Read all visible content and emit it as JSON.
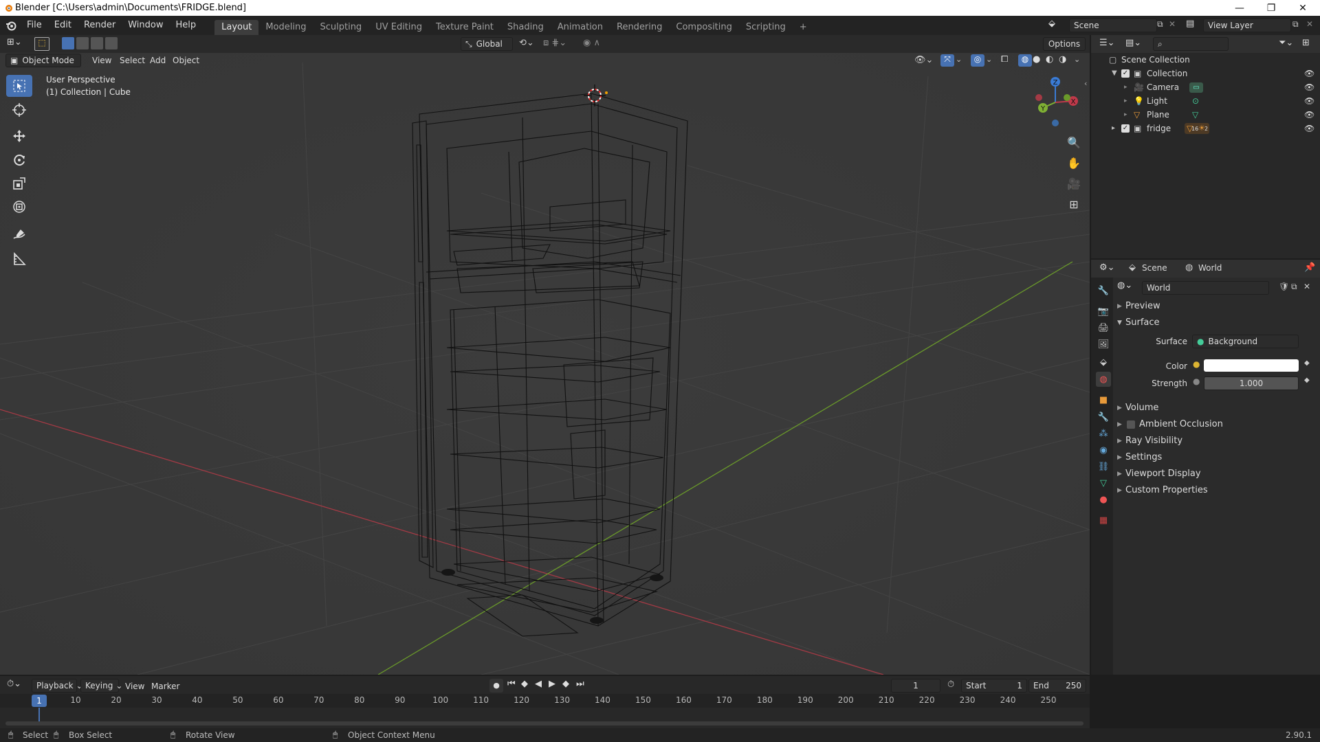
{
  "window": {
    "title": "Blender [C:\\Users\\admin\\Documents\\FRIDGE.blend]",
    "min_symbol": "—",
    "max_symbol": "❐",
    "close_symbol": "✕"
  },
  "menu": [
    "File",
    "Edit",
    "Render",
    "Window",
    "Help"
  ],
  "workspaces": [
    {
      "label": "Layout",
      "active": true
    },
    {
      "label": "Modeling"
    },
    {
      "label": "Sculpting"
    },
    {
      "label": "UV Editing"
    },
    {
      "label": "Texture Paint"
    },
    {
      "label": "Shading"
    },
    {
      "label": "Animation"
    },
    {
      "label": "Rendering"
    },
    {
      "label": "Compositing"
    },
    {
      "label": "Scripting"
    }
  ],
  "add_workspace": "+",
  "scene_field": "Scene",
  "view_layer_field": "View Layer",
  "tool_header": {
    "transform_orientation": "Global",
    "options": "Options"
  },
  "viewport_header": {
    "mode": "Object Mode",
    "menus": [
      "View",
      "Select",
      "Add",
      "Object"
    ]
  },
  "viewport": {
    "perspective": "User Perspective",
    "collection_info": "(1) Collection | Cube",
    "gizmo_labels": {
      "z": "Z",
      "y": "Y",
      "x": "X"
    }
  },
  "outliner": {
    "rows": [
      {
        "label": "Scene Collection"
      },
      {
        "label": "Collection"
      },
      {
        "label": "Camera"
      },
      {
        "label": "Light"
      },
      {
        "label": "Plane"
      },
      {
        "label": "fridge"
      }
    ],
    "fridge_badges": [
      "16",
      "2"
    ]
  },
  "properties": {
    "scene_label": "Scene",
    "world_label": "World",
    "world_name": "World",
    "panels": {
      "preview": "Preview",
      "surface": "Surface",
      "volume": "Volume",
      "ambient_occlusion": "Ambient Occlusion",
      "ray_visibility": "Ray Visibility",
      "settings": "Settings",
      "viewport_display": "Viewport Display",
      "custom_properties": "Custom Properties"
    },
    "surface_label": "Surface",
    "surface_value": "Background",
    "color_label": "Color",
    "color_value": "#ffffff",
    "strength_label": "Strength",
    "strength_value": "1.000"
  },
  "timeline": {
    "menus": [
      "Playback",
      "Keying",
      "View",
      "Marker"
    ],
    "current_frame": "1",
    "start_label": "Start",
    "start_value": "1",
    "end_label": "End",
    "end_value": "250",
    "ticks": [
      "1",
      "10",
      "20",
      "30",
      "40",
      "50",
      "60",
      "70",
      "80",
      "90",
      "100",
      "110",
      "120",
      "130",
      "140",
      "150",
      "160",
      "170",
      "180",
      "190",
      "200",
      "210",
      "220",
      "230",
      "240",
      "250"
    ],
    "playhead_frame": 1
  },
  "statusbar": {
    "select": "Select",
    "box_select": "Box Select",
    "rotate_view": "Rotate View",
    "context_menu": "Object Context Menu",
    "version": "2.90.1"
  },
  "colors": {
    "accent": "#4772b3",
    "viewport_bg": "#393939",
    "x_axis": "#c0394a",
    "y_axis": "#7fb034",
    "z_axis": "#3a7bd5"
  }
}
